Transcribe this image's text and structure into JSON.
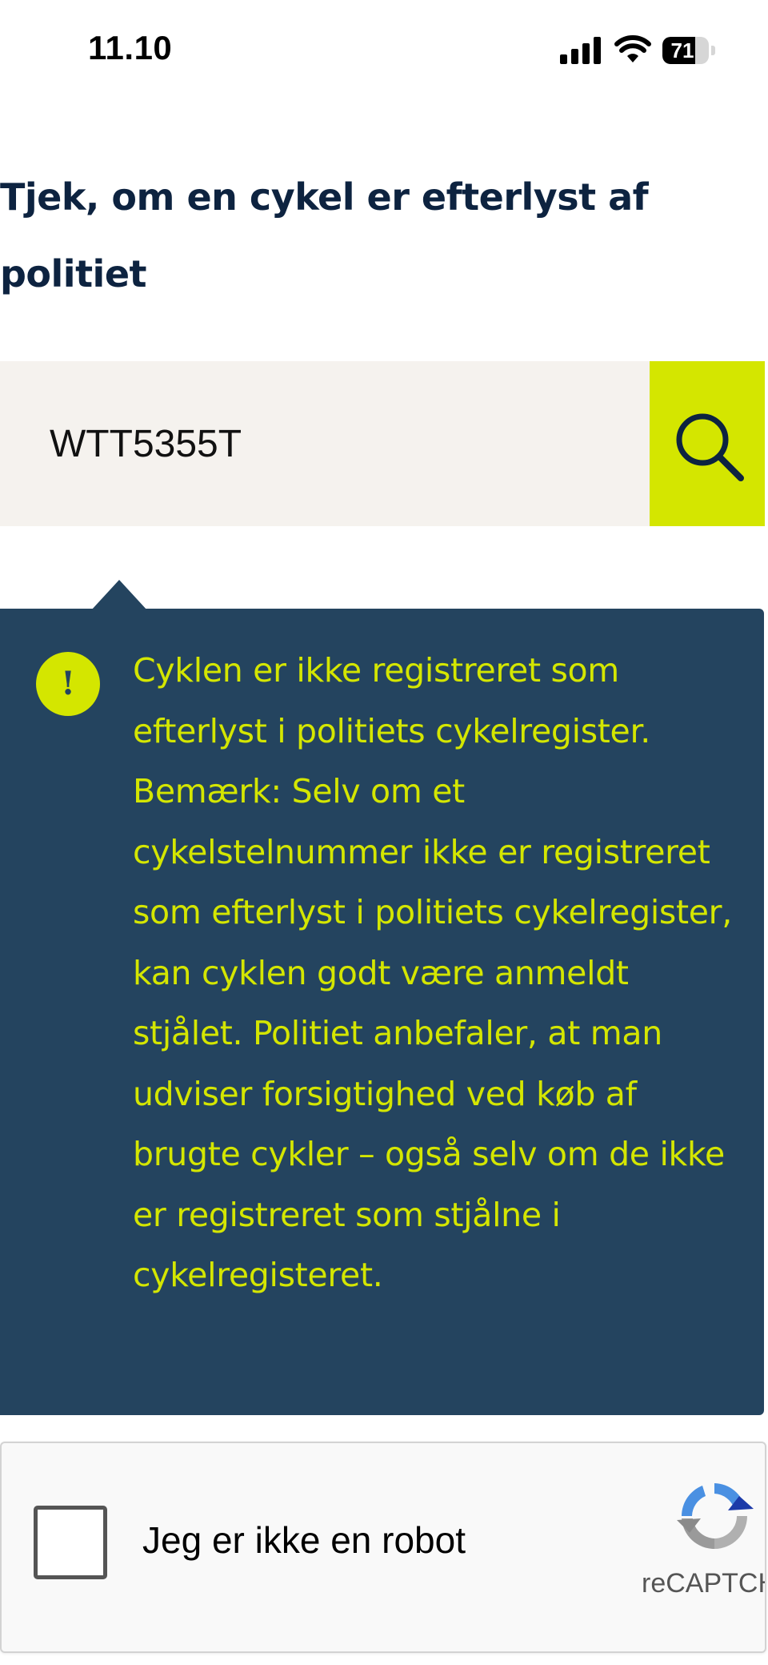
{
  "status_bar": {
    "time": "11.10",
    "battery_percent": 71,
    "battery_label": "71"
  },
  "page": {
    "title": "Tjek, om en cykel er efterlyst af politiet"
  },
  "search": {
    "value": "WTT5355T",
    "icon": "search-icon"
  },
  "result": {
    "icon": "exclamation-icon",
    "icon_glyph": "!",
    "message": "Cyklen er ikke registreret som efterlyst i politiets cykelregister. Bemærk: Selv om et cykelstelnummer ikke er registreret som efterlyst i politiets cykelregister, kan cyklen godt være anmeldt stjålet. Politiet anbefaler, at man udviser forsigtighed ved køb af brugte cykler – også selv om de ikke er registreret som stjålne i cykelregisteret."
  },
  "recaptcha": {
    "label": "Jeg er ikke en robot",
    "brand": "reCAPTCHA",
    "checked": false
  },
  "colors": {
    "heading": "#0d2340",
    "search_background": "#f5f2ee",
    "accent": "#d4e600",
    "result_background": "#24445f"
  }
}
